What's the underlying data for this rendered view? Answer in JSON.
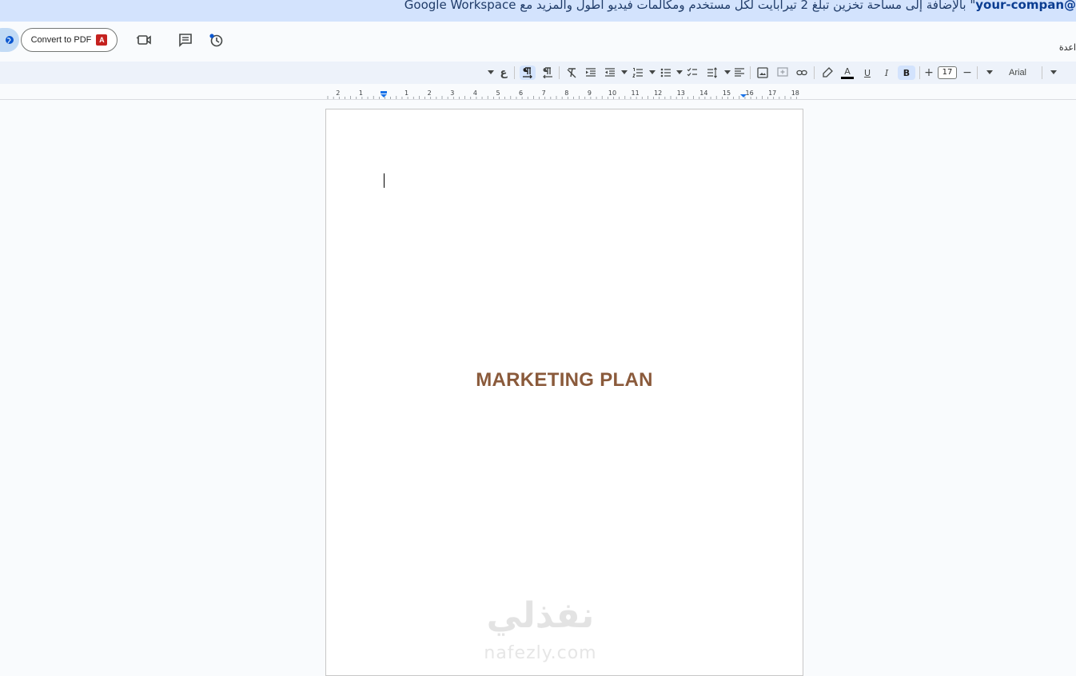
{
  "banner": {
    "email_fragment": "@your-compan",
    "message": "\" بالإضافة إلى مساحة تخزين تبلغ 2 تيرابايت لكل مستخدم ومكالمات فيديو أطول والمزيد مع Google Workspace"
  },
  "header": {
    "convert_pdf_label": "Convert to PDF",
    "pdf_badge": "A",
    "help_text": "اعدة"
  },
  "toolbar": {
    "font_size": "17",
    "font_name": "Arial",
    "bold_glyph": "B",
    "italic_glyph": "I",
    "underline_glyph": "U",
    "text_color_glyph": "A",
    "arabic_glyph": "ع",
    "plus_glyph": "+",
    "minus_glyph": "−",
    "accent_color": "#d3e3fd"
  },
  "ruler": {
    "labels": [
      "2",
      "1",
      "1",
      "2",
      "3",
      "4",
      "5",
      "6",
      "7",
      "8",
      "9",
      "10",
      "11",
      "12",
      "13",
      "14",
      "15",
      "16",
      "17",
      "18"
    ]
  },
  "document": {
    "title": "MARKETING PLAN",
    "title_color": "#8a5a3b"
  },
  "watermark": {
    "logo_text": "نفذلي",
    "url": "nafezly.com"
  }
}
